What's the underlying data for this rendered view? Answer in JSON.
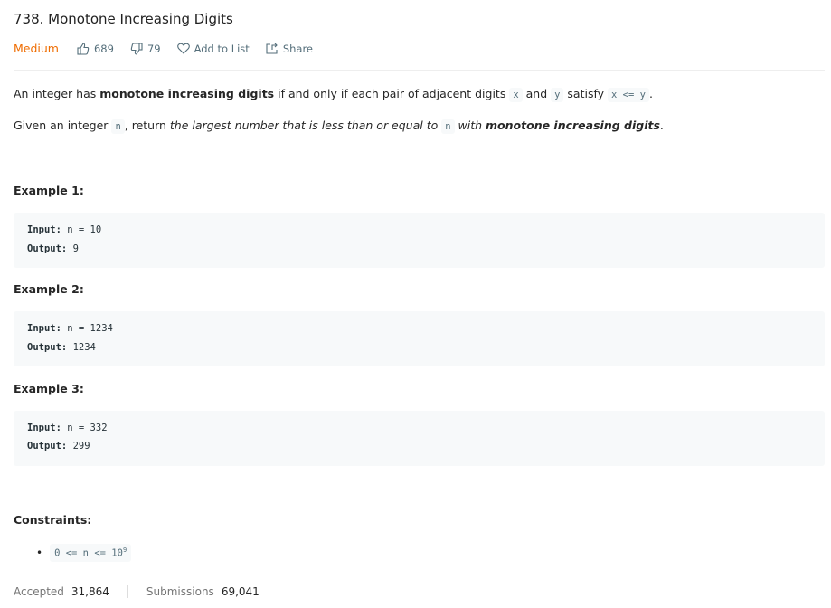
{
  "title": "738. Monotone Increasing Digits",
  "meta": {
    "difficulty": "Medium",
    "likes": "689",
    "dislikes": "79",
    "add_to_list": "Add to List",
    "share": "Share"
  },
  "description": {
    "p1": {
      "a": "An integer has ",
      "b": "monotone increasing digits",
      "c": " if and only if each pair of adjacent digits ",
      "x": "x",
      "d": " and ",
      "y": "y",
      "e": " satisfy ",
      "cond": "x <= y",
      "f": "."
    },
    "p2": {
      "a": "Given an integer ",
      "n": "n",
      "b": ", return ",
      "c": "the largest number that is less than or equal to ",
      "n2": "n",
      "d": " with ",
      "e": "monotone increasing digits",
      "f": "."
    }
  },
  "examples": [
    {
      "heading": "Example 1:",
      "input_label": "Input:",
      "input": "n = 10",
      "output_label": "Output:",
      "output": "9"
    },
    {
      "heading": "Example 2:",
      "input_label": "Input:",
      "input": "n = 1234",
      "output_label": "Output:",
      "output": "1234"
    },
    {
      "heading": "Example 3:",
      "input_label": "Input:",
      "input": "n = 332",
      "output_label": "Output:",
      "output": "299"
    }
  ],
  "constraints": {
    "heading": "Constraints:",
    "items": [
      {
        "text": "0 <= n <= 10",
        "sup": "9"
      }
    ]
  },
  "footer": {
    "accepted_label": "Accepted",
    "accepted": "31,864",
    "submissions_label": "Submissions",
    "submissions": "69,041"
  }
}
